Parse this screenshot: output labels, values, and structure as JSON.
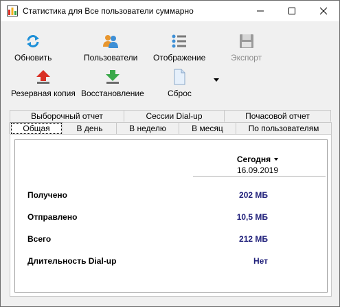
{
  "window": {
    "title": "Статистика для Все пользователи суммарно"
  },
  "toolbar": {
    "refresh": "Обновить",
    "users": "Пользователи",
    "display": "Отображение",
    "export": "Экспорт",
    "backup": "Резервная копия",
    "restore": "Восстановление",
    "reset": "Сброс"
  },
  "tabs": {
    "row1": [
      "Выборочный отчет",
      "Сессии Dial-up",
      "Почасовой отчет"
    ],
    "row2": [
      "Общая",
      "В день",
      "В неделю",
      "В месяц",
      "По пользователям"
    ]
  },
  "table": {
    "period": "Сегодня",
    "date": "16.09.2019",
    "rows": [
      {
        "label": "Получено",
        "value": "202 МБ"
      },
      {
        "label": "Отправлено",
        "value": "10,5 МБ"
      },
      {
        "label": "Всего",
        "value": "212 МБ"
      },
      {
        "label": "Длительность Dial-up",
        "value": "Нет"
      }
    ]
  },
  "colors": {
    "value_text": "#1f1f7a",
    "refresh_icon": "#1e90d8",
    "backup_arrow": "#d93025",
    "restore_arrow": "#3aa84a"
  }
}
